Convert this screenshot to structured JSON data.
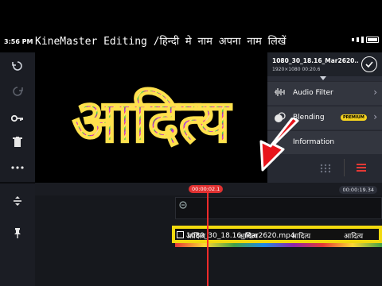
{
  "status_bar": {
    "time": "3:56 PM"
  },
  "overlay_title": "KineMaster Editing /हिन्दी मे नाम अपना नाम लिखें",
  "preview": {
    "text": "आदित्य"
  },
  "clip": {
    "name": "1080_30_18.16_Mar2620...",
    "meta": "1920×1080  00:20.6"
  },
  "menu": {
    "audio_filter": "Audio Filter",
    "blending": "Blending",
    "premium_badge": "PREMIUM",
    "information": "Information"
  },
  "timeline": {
    "playhead_time": "00:00:02.1",
    "end_time": "00:00:19.34",
    "clip_label": "1080_30_18.16_Mar2620.mp4",
    "text_repeat": [
      "आदित्य",
      "आदित्य",
      "आदित्य",
      "आदित्य"
    ]
  },
  "colors": {
    "accent_red": "#e03131",
    "premium_yellow": "#f4d21e",
    "panel_bg": "#2b2e38"
  }
}
